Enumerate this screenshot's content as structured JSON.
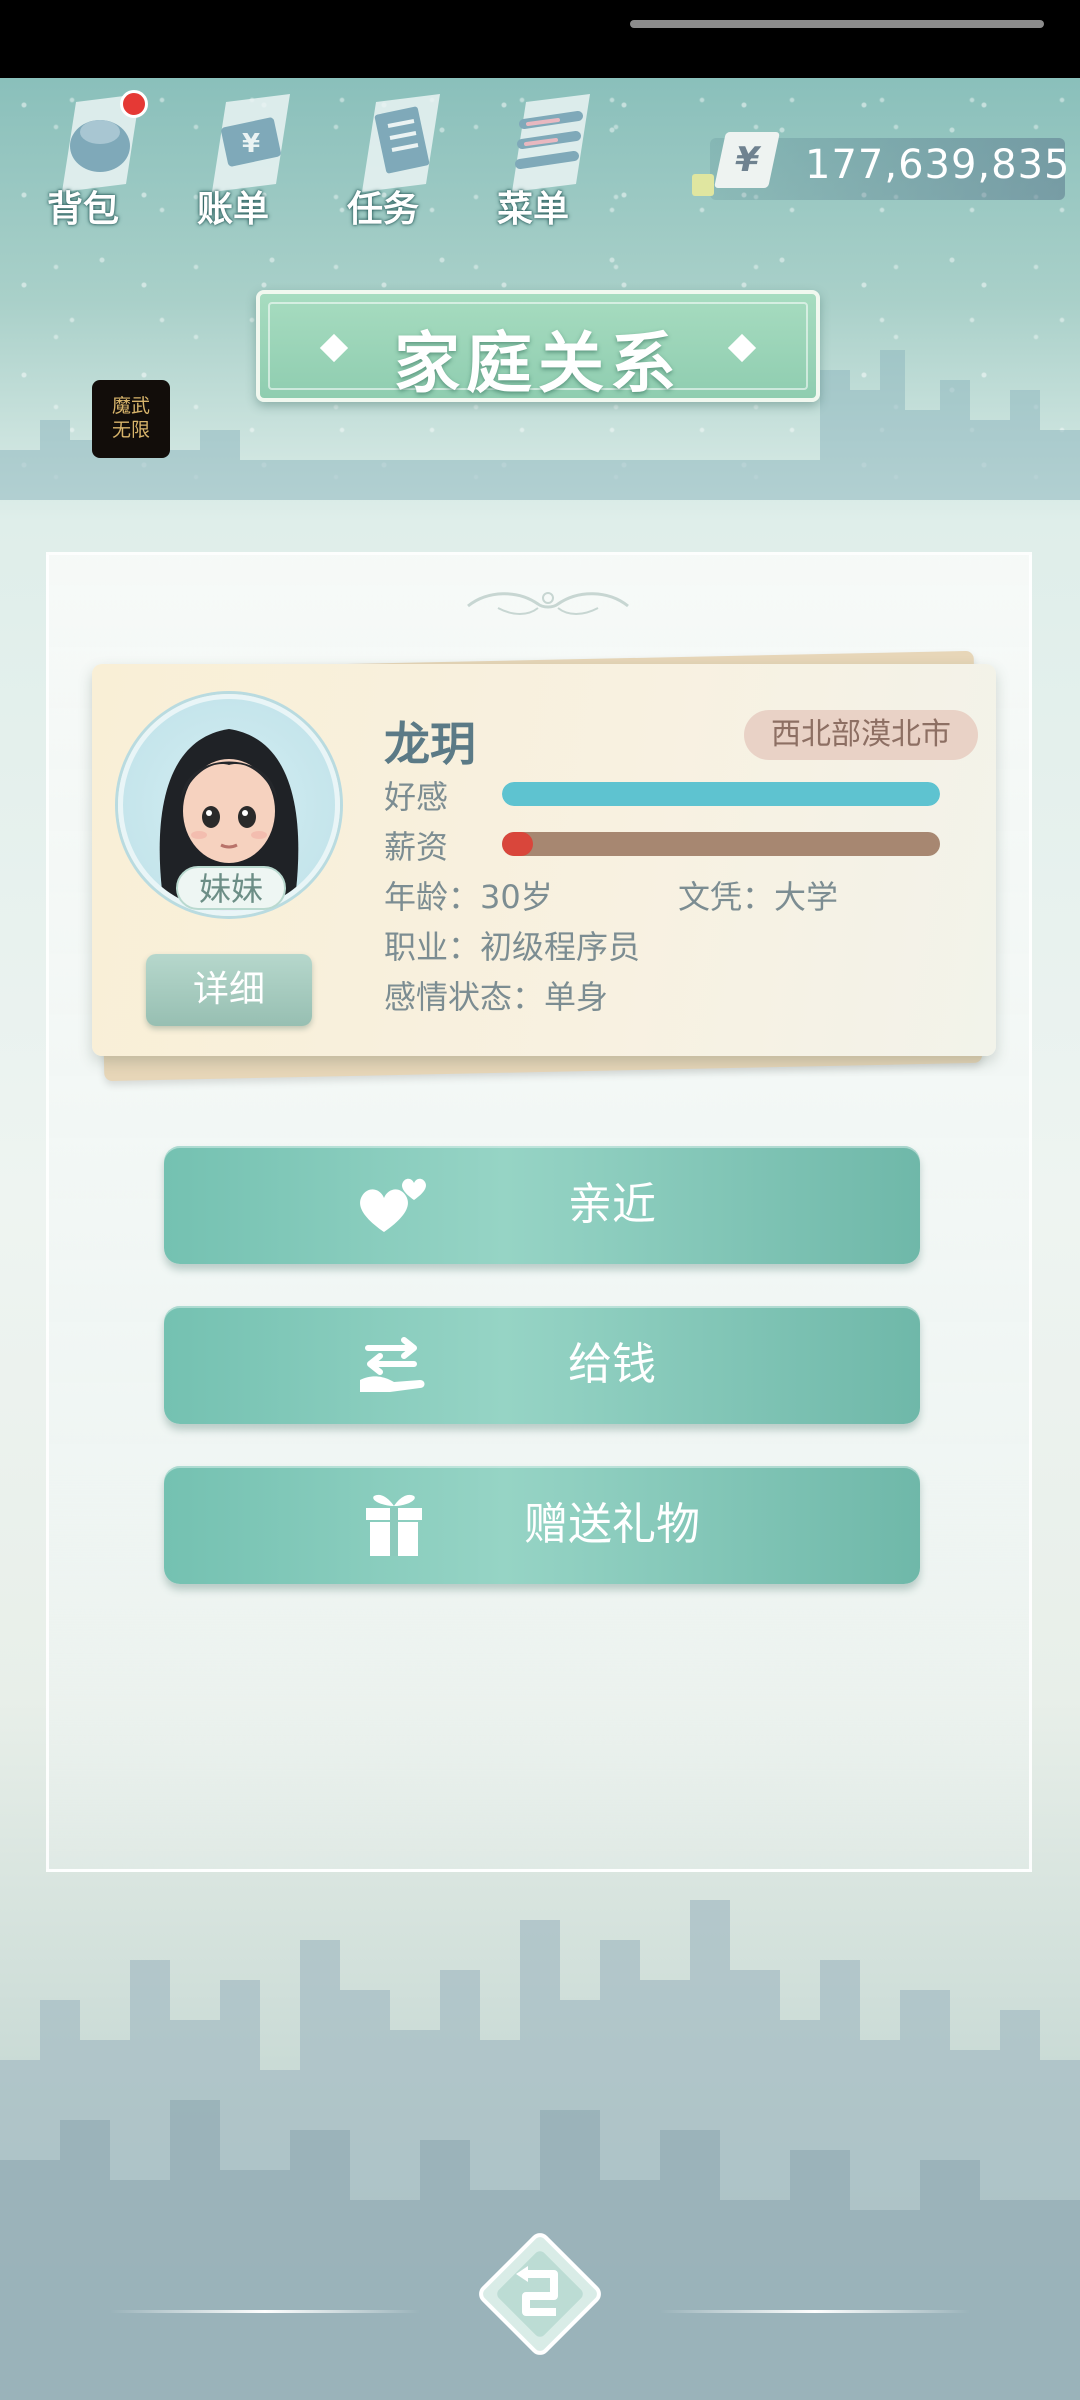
{
  "toolbar": {
    "items": [
      {
        "label": "背包",
        "icon": "backpack-icon",
        "has_badge": true
      },
      {
        "label": "账单",
        "icon": "bill-icon"
      },
      {
        "label": "任务",
        "icon": "task-icon"
      },
      {
        "label": "菜单",
        "icon": "menu-icon"
      }
    ]
  },
  "currency": {
    "symbol": "¥",
    "amount": "177,639,835"
  },
  "page": {
    "title": "家庭关系"
  },
  "app_logo": {
    "text": "魔武无限",
    "line1": "魔武",
    "line2": "无限"
  },
  "character": {
    "name": "龙玥",
    "location": "西北部漠北市",
    "relation": "妹妹",
    "detail_button": "详细",
    "favor_label": "好感",
    "favor_level": 1.0,
    "salary_label": "薪资",
    "salary_level": 0.07,
    "age_text": "年龄：30岁",
    "education_text": "文凭：大学",
    "job_text": "职业：初级程序员",
    "relationship_text": "感情状态：单身"
  },
  "actions": [
    {
      "label": "亲近",
      "icon": "hearts-icon"
    },
    {
      "label": "给钱",
      "icon": "give-money-icon"
    },
    {
      "label": "赠送礼物",
      "icon": "gift-icon"
    }
  ],
  "colors": {
    "favor_bar": "#5ec3d0",
    "salary_bar_fill": "#d9463b",
    "salary_bar_track": "#a78771",
    "button_teal": "#7ec6b6"
  }
}
